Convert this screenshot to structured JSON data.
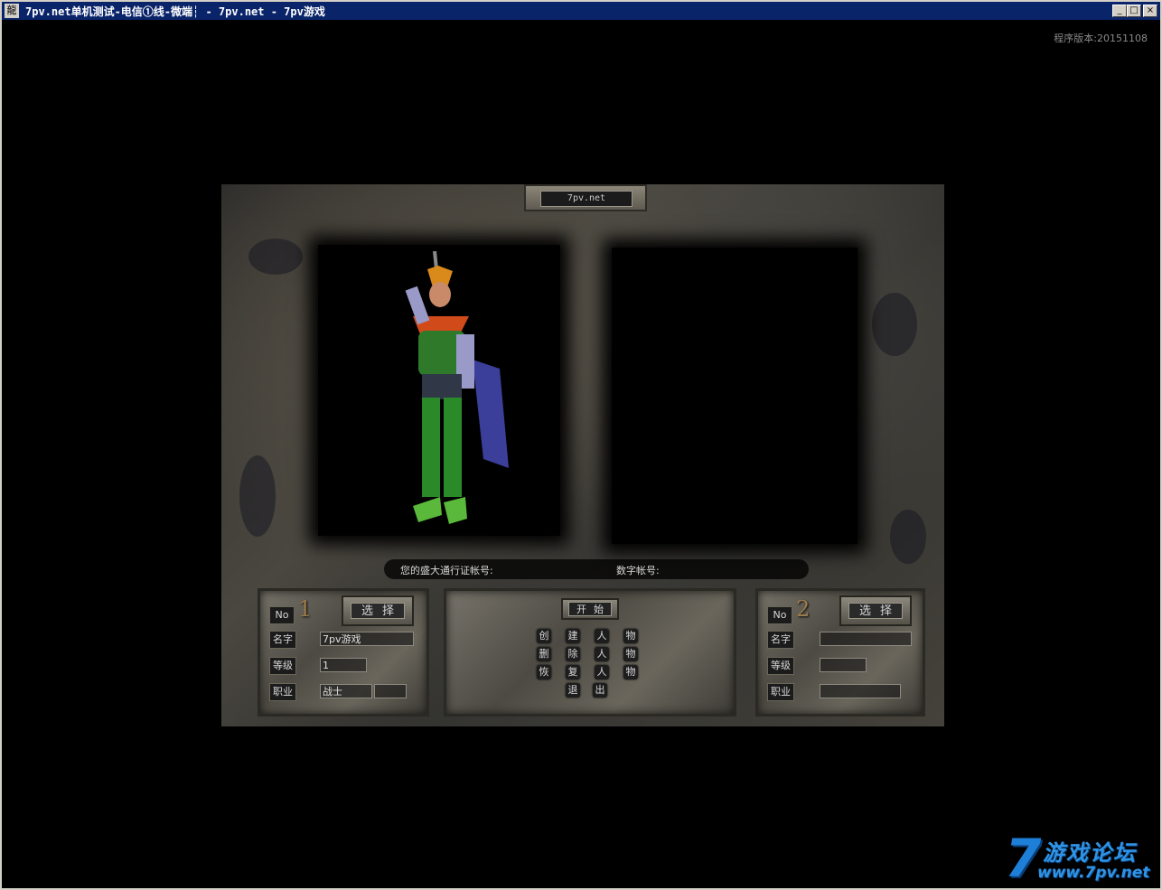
{
  "window": {
    "title": "7pv.net单机测试-电信①线-微端┆ - 7pv.net - 7pv游戏",
    "icon_name": "app-icon",
    "icon_glyph": "龍",
    "minimize": "_",
    "maximize": "□",
    "close": "×"
  },
  "version_text": "程序版本:20151108",
  "server_name": "7pv.net",
  "account": {
    "passport_label": "您的盛大通行证帐号:",
    "digital_label": "数字帐号:"
  },
  "slots": [
    {
      "no_label": "No",
      "number": "1",
      "select_label": "选择",
      "name_label": "名字",
      "name_value": "7pv游戏",
      "level_label": "等级",
      "level_value": "1",
      "job_label": "职业",
      "job_value": "战士"
    },
    {
      "no_label": "No",
      "number": "2",
      "select_label": "选择",
      "name_label": "名字",
      "name_value": "",
      "level_label": "等级",
      "level_value": "",
      "job_label": "职业",
      "job_value": ""
    }
  ],
  "menu": {
    "start_label": "开始",
    "create": [
      "创",
      "建",
      "人",
      "物"
    ],
    "delete": [
      "删",
      "除",
      "人",
      "物"
    ],
    "restore": [
      "恢",
      "复",
      "人",
      "物"
    ],
    "exit": [
      "退",
      "出"
    ]
  },
  "watermark": {
    "seven": "7",
    "text": "游戏论坛",
    "url": "www.7pv.net"
  },
  "colors": {
    "titlebar": "#0a246a",
    "watermark_blue": "#1e7fd8",
    "stone": "#5e5a50"
  }
}
